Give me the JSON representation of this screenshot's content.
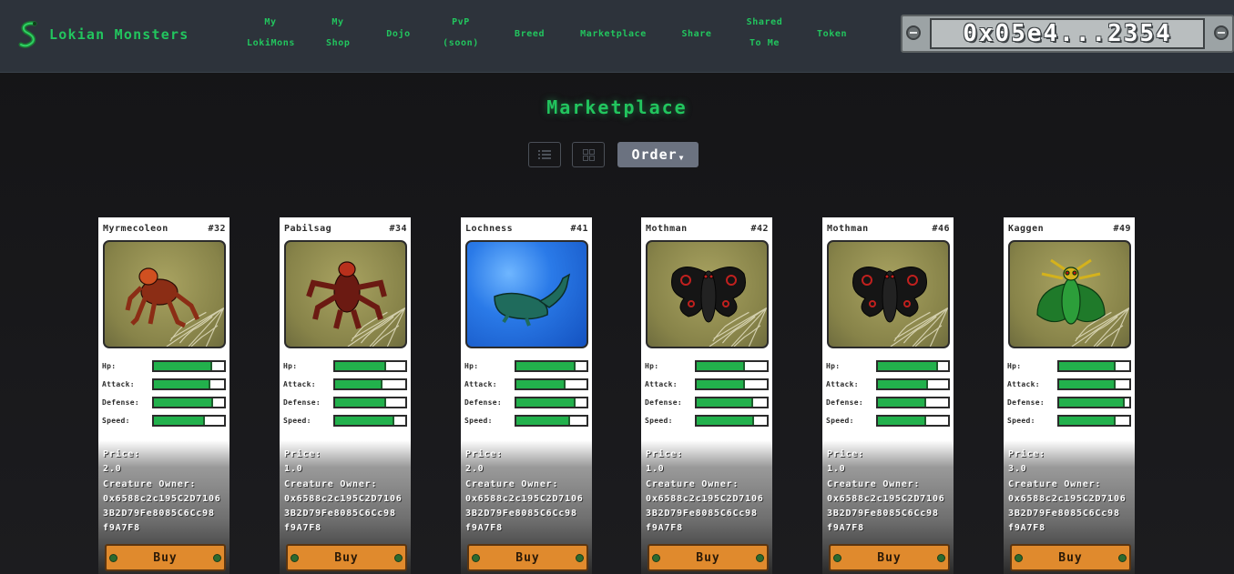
{
  "nav": {
    "brand": "Lokian Monsters",
    "items": [
      {
        "lines": [
          "My",
          "LokiMons"
        ]
      },
      {
        "lines": [
          "My",
          "Shop"
        ]
      },
      {
        "lines": [
          "Dojo"
        ]
      },
      {
        "lines": [
          "PvP",
          "(soon)"
        ]
      },
      {
        "lines": [
          "Breed"
        ]
      },
      {
        "lines": [
          "Marketplace"
        ]
      },
      {
        "lines": [
          "Share"
        ]
      },
      {
        "lines": [
          "Shared",
          "To Me"
        ]
      },
      {
        "lines": [
          "Token"
        ]
      }
    ],
    "wallet": "0x05e4...2354"
  },
  "page": {
    "title": "Marketplace",
    "order_label": "Order"
  },
  "labels": {
    "hp": "Hp:",
    "attack": "Attack:",
    "defense": "Defense:",
    "speed": "Speed:",
    "price": "Price:",
    "owner": "Creature Owner:",
    "buy": "Buy"
  },
  "cards": [
    {
      "name": "Myrmecoleon",
      "id": "#32",
      "price": "2.0",
      "owner": "0x6588c2c195C2D7106 3B2D79Fe8085C6Cc98 f9A7F8",
      "hp": 0.83,
      "attack": 0.8,
      "defense": 0.85,
      "speed": 0.73,
      "art": "spider",
      "color": "#8b2d15",
      "accent": "#d05020"
    },
    {
      "name": "Pabilsag",
      "id": "#34",
      "price": "1.0",
      "owner": "0x6588c2c195C2D7106 3B2D79Fe8085C6Cc98 f9A7F8",
      "hp": 0.73,
      "attack": 0.68,
      "defense": 0.73,
      "speed": 0.84,
      "art": "demon",
      "color": "#6b1a12",
      "accent": "#b8301c"
    },
    {
      "name": "Lochness",
      "id": "#41",
      "price": "2.0",
      "owner": "0x6588c2c195C2D7106 3B2D79Fe8085C6Cc98 f9A7F8",
      "hp": 0.84,
      "attack": 0.7,
      "defense": 0.84,
      "speed": 0.77,
      "art": "nessie",
      "color": "#1f6b5c",
      "accent": "#2f8f78"
    },
    {
      "name": "Mothman",
      "id": "#42",
      "price": "1.0",
      "owner": "0x6588c2c195C2D7106 3B2D79Fe8085C6Cc98 f9A7F8",
      "hp": 0.69,
      "attack": 0.69,
      "defense": 0.81,
      "speed": 0.82,
      "art": "moth",
      "color": "#151515",
      "accent": "#c0201e"
    },
    {
      "name": "Mothman",
      "id": "#46",
      "price": "1.0",
      "owner": "0x6588c2c195C2D7106 3B2D79Fe8085C6Cc98 f9A7F8",
      "hp": 0.86,
      "attack": 0.72,
      "defense": 0.69,
      "speed": 0.69,
      "art": "moth",
      "color": "#151515",
      "accent": "#c0201e"
    },
    {
      "name": "Kaggen",
      "id": "#49",
      "price": "3.0",
      "owner": "0x6588c2c195C2D7106 3B2D79Fe8085C6Cc98 f9A7F8",
      "hp": 0.8,
      "attack": 0.8,
      "defense": 0.93,
      "speed": 0.8,
      "art": "mantis",
      "color": "#1f7a2a",
      "accent": "#d4b21c"
    }
  ]
}
